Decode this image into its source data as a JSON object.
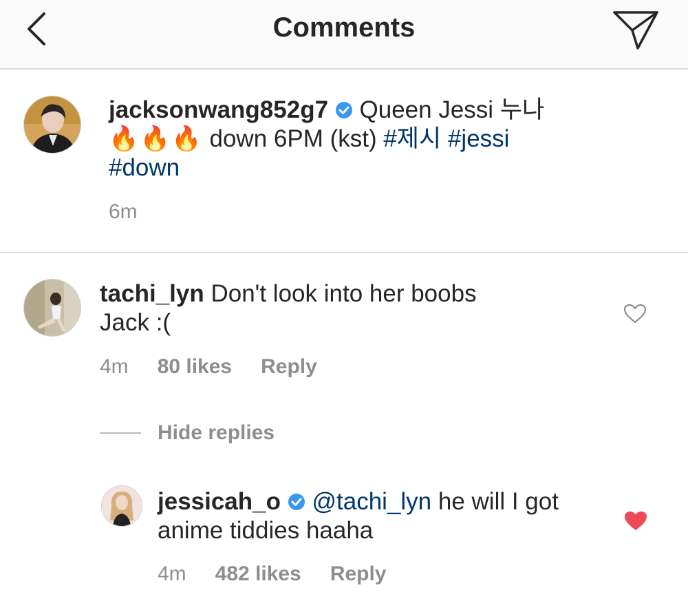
{
  "header": {
    "title": "Comments",
    "back_icon": "chevron-left-icon",
    "share_icon": "direct-message-icon"
  },
  "caption": {
    "username": "jacksonwang852g7",
    "text_part1": "Queen Jessi 누나",
    "fire_emojis": "🔥🔥🔥",
    "text_part2": "down 6PM (kst)",
    "tag1": "#제시",
    "tag2": "#jessi",
    "tag3": "#down",
    "time": "6m"
  },
  "comment": {
    "username": "tachi_lyn",
    "text_line1": "Don't look into her boobs",
    "text_line2": "Jack :(",
    "time": "4m",
    "likes": "80 likes",
    "reply": "Reply",
    "liked": false
  },
  "hide_replies": "Hide replies",
  "reply": {
    "username": "jessicah_o",
    "mention": "@tachi_lyn",
    "text_line1": "he will I got",
    "text_line2": "anime tiddies haaha",
    "time": "4m",
    "likes": "482 likes",
    "reply": "Reply",
    "liked": true
  },
  "colors": {
    "link": "#00376b",
    "verified": "#3897f0",
    "liked_heart": "#ed4956",
    "meta_text": "#8e8e8e"
  }
}
